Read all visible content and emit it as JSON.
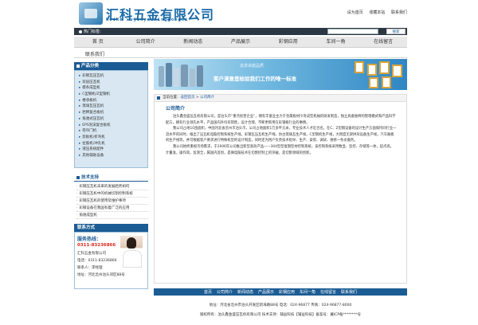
{
  "brand": {
    "title": "汇科五金有限公司",
    "subtitle": "HuiKe wujinyouxinggongsi"
  },
  "top_links": [
    "设为首页",
    "收藏本站",
    "联系我们"
  ],
  "search": {
    "label": "热门标签:",
    "placeholder": "",
    "button_label": "搜索"
  },
  "nav": [
    "首 页",
    "公司简介",
    "新闻动态",
    "产品展示",
    "彩钢应用",
    "车间一角",
    "在线留言"
  ],
  "subnav": "联系我们",
  "sidebar": {
    "products_head": "产品分类",
    "categories": [
      "彩钢瓦压瓦机",
      "双层压瓦机",
      "檩条成型机",
      "C型钢机/Z型钢机",
      "楼承板机",
      "琉璃瓦压瓦机",
      "岩棉复合板机",
      "角驰式压瓦机",
      "EPS泡沫复合板机",
      "卷帘门机",
      "剪板机/折弯机",
      "拉筋机/冲孔机",
      "液压系统配件",
      "其他辅助设备"
    ],
    "tech_head": "技术支持",
    "tech_items": [
      "彩钢压瓦机未来的发展趋势如何",
      "彩钢压瓦机中的机械切割控制系统",
      "彩钢压瓦机的使用及维护事项",
      "彩钢设备在我国有着广泛的应用",
      "角驰成型机"
    ],
    "contact_head": "联系方式",
    "hotline_label": "服务热线：",
    "hotline_number": "0311-83236866",
    "contact_lines": [
      "汇科五金有限公司",
      "电话：0311-83236866",
      "联系人：李经理",
      "地址：河北沧州泊头郊区88号"
    ]
  },
  "banner": {
    "tag": "追求卓越品质",
    "slogan": "客户满意是检验我们工作的唯一标准"
  },
  "breadcrumb": {
    "prefix": "当前位置：",
    "home": "返回首页",
    "sep": " > ",
    "current": "公司简介"
  },
  "content": {
    "title": "公司简介",
    "paragraphs": [
      "泊头鑫金盛压瓦机有限公司，是泊头市“重点民营企业”，拥有丰富业主力于金属板材冷弯成型机械的研发制造，独立具备独特的管理模式和产品科学配方，拥有行业领先水平，产品国内外均有销售，设计合理，不断更新用在彩钢板行业的事情。",
      "我公司占地10亩面积，中国河北省沧州市泊头市，公司占地面积1万多平方米，专业技术人才近百名。在C、Z型钢设备的设计生产方面保持同行业一流水平的同时，推出了压瓦机电脑控制系统生产线，彩钢瓦压瓦机生产线，仿古琉璃瓦生产线，C型钢机生产线，大跨度无梁拱形设备生产线，汽车厢板机生产线等，并可根据客户要求进行特殊机型的设计制造，同时还为用户负责技术指导、生产、安装、调试、维修一条龙服务。",
      "我公司始终重视市场需求，于2006年公司推出新型高效产品——304型型复钢型材控制系统，该控制系统采用数显、监控、存储等一体，起点高，计量准，操作简，监测全，属国内首创，是微电脑技术在切割控制上的突破，是切割领域的创新。"
    ]
  },
  "footer": {
    "links": [
      "首页",
      "公司简介",
      "新闻动态",
      "产品展示",
      "彩钢应用",
      "车间一角",
      "在线留言",
      "联系我们"
    ],
    "address_line": "地址：河北省沧州市泊头开发区新海路88号  电话：024-96877  传真：024-96877-8000",
    "copyright_line": "版权所有：泊头鑫金盛压瓦机有限公司  技术支持：辅益科技【辅益科技】备案号：冀ICP备********号"
  },
  "colors": {
    "primary": "#1c5c94",
    "hotline": "#d8261a",
    "banner_start": "#bfe2f4",
    "banner_end": "#2f86c3"
  }
}
